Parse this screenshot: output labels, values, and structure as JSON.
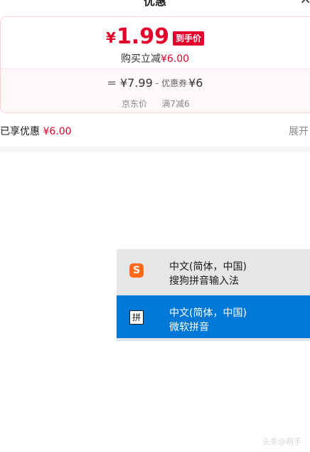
{
  "header": {
    "title": "优惠",
    "close_icon": "close-icon"
  },
  "price_card": {
    "currency_symbol": "¥",
    "final_price": "1.99",
    "final_badge": "到手价",
    "instant_discount_prefix": "购买立减",
    "instant_discount_value": "¥6.00",
    "equals_sign": "=",
    "jd_price": "¥7.99",
    "minus_sign": "-",
    "coupon_label": "优惠券",
    "coupon_value": "¥6",
    "jd_price_label": "京东价",
    "coupon_rule": "满7减6"
  },
  "enjoyed": {
    "label": "已享优惠",
    "value": "¥6.00",
    "expand_label": "展开"
  },
  "ime_menu": {
    "items": [
      {
        "language": "中文(简体，中国)",
        "method": "搜狗拼音输入法",
        "icon": "sogou-icon",
        "icon_glyph": "S",
        "selected": false
      },
      {
        "language": "中文(简体，中国)",
        "method": "微软拼音",
        "icon": "pinyin-icon",
        "icon_glyph": "拼",
        "selected": true
      }
    ]
  },
  "watermark": "头条@萌手",
  "colors": {
    "accent_red": "#e4002b",
    "ime_selected": "#0078d7",
    "sogou_orange": "#ff6a1a"
  }
}
